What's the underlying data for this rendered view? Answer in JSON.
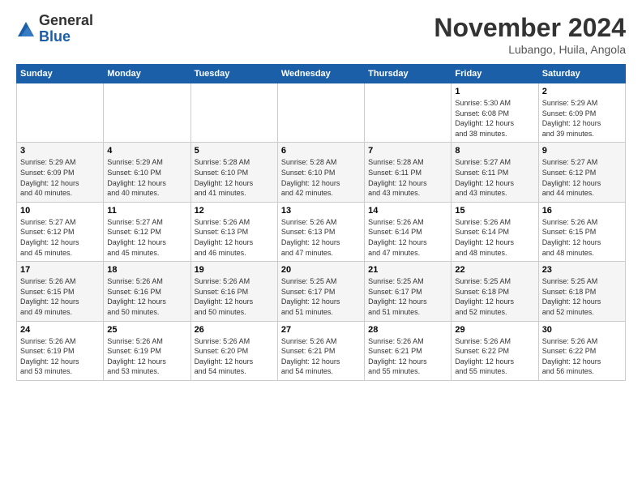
{
  "logo": {
    "general": "General",
    "blue": "Blue"
  },
  "header": {
    "month": "November 2024",
    "location": "Lubango, Huila, Angola"
  },
  "weekdays": [
    "Sunday",
    "Monday",
    "Tuesday",
    "Wednesday",
    "Thursday",
    "Friday",
    "Saturday"
  ],
  "weeks": [
    [
      {
        "day": "",
        "info": ""
      },
      {
        "day": "",
        "info": ""
      },
      {
        "day": "",
        "info": ""
      },
      {
        "day": "",
        "info": ""
      },
      {
        "day": "",
        "info": ""
      },
      {
        "day": "1",
        "info": "Sunrise: 5:30 AM\nSunset: 6:08 PM\nDaylight: 12 hours\nand 38 minutes."
      },
      {
        "day": "2",
        "info": "Sunrise: 5:29 AM\nSunset: 6:09 PM\nDaylight: 12 hours\nand 39 minutes."
      }
    ],
    [
      {
        "day": "3",
        "info": "Sunrise: 5:29 AM\nSunset: 6:09 PM\nDaylight: 12 hours\nand 40 minutes."
      },
      {
        "day": "4",
        "info": "Sunrise: 5:29 AM\nSunset: 6:10 PM\nDaylight: 12 hours\nand 40 minutes."
      },
      {
        "day": "5",
        "info": "Sunrise: 5:28 AM\nSunset: 6:10 PM\nDaylight: 12 hours\nand 41 minutes."
      },
      {
        "day": "6",
        "info": "Sunrise: 5:28 AM\nSunset: 6:10 PM\nDaylight: 12 hours\nand 42 minutes."
      },
      {
        "day": "7",
        "info": "Sunrise: 5:28 AM\nSunset: 6:11 PM\nDaylight: 12 hours\nand 43 minutes."
      },
      {
        "day": "8",
        "info": "Sunrise: 5:27 AM\nSunset: 6:11 PM\nDaylight: 12 hours\nand 43 minutes."
      },
      {
        "day": "9",
        "info": "Sunrise: 5:27 AM\nSunset: 6:12 PM\nDaylight: 12 hours\nand 44 minutes."
      }
    ],
    [
      {
        "day": "10",
        "info": "Sunrise: 5:27 AM\nSunset: 6:12 PM\nDaylight: 12 hours\nand 45 minutes."
      },
      {
        "day": "11",
        "info": "Sunrise: 5:27 AM\nSunset: 6:12 PM\nDaylight: 12 hours\nand 45 minutes."
      },
      {
        "day": "12",
        "info": "Sunrise: 5:26 AM\nSunset: 6:13 PM\nDaylight: 12 hours\nand 46 minutes."
      },
      {
        "day": "13",
        "info": "Sunrise: 5:26 AM\nSunset: 6:13 PM\nDaylight: 12 hours\nand 47 minutes."
      },
      {
        "day": "14",
        "info": "Sunrise: 5:26 AM\nSunset: 6:14 PM\nDaylight: 12 hours\nand 47 minutes."
      },
      {
        "day": "15",
        "info": "Sunrise: 5:26 AM\nSunset: 6:14 PM\nDaylight: 12 hours\nand 48 minutes."
      },
      {
        "day": "16",
        "info": "Sunrise: 5:26 AM\nSunset: 6:15 PM\nDaylight: 12 hours\nand 48 minutes."
      }
    ],
    [
      {
        "day": "17",
        "info": "Sunrise: 5:26 AM\nSunset: 6:15 PM\nDaylight: 12 hours\nand 49 minutes."
      },
      {
        "day": "18",
        "info": "Sunrise: 5:26 AM\nSunset: 6:16 PM\nDaylight: 12 hours\nand 50 minutes."
      },
      {
        "day": "19",
        "info": "Sunrise: 5:26 AM\nSunset: 6:16 PM\nDaylight: 12 hours\nand 50 minutes."
      },
      {
        "day": "20",
        "info": "Sunrise: 5:25 AM\nSunset: 6:17 PM\nDaylight: 12 hours\nand 51 minutes."
      },
      {
        "day": "21",
        "info": "Sunrise: 5:25 AM\nSunset: 6:17 PM\nDaylight: 12 hours\nand 51 minutes."
      },
      {
        "day": "22",
        "info": "Sunrise: 5:25 AM\nSunset: 6:18 PM\nDaylight: 12 hours\nand 52 minutes."
      },
      {
        "day": "23",
        "info": "Sunrise: 5:25 AM\nSunset: 6:18 PM\nDaylight: 12 hours\nand 52 minutes."
      }
    ],
    [
      {
        "day": "24",
        "info": "Sunrise: 5:26 AM\nSunset: 6:19 PM\nDaylight: 12 hours\nand 53 minutes."
      },
      {
        "day": "25",
        "info": "Sunrise: 5:26 AM\nSunset: 6:19 PM\nDaylight: 12 hours\nand 53 minutes."
      },
      {
        "day": "26",
        "info": "Sunrise: 5:26 AM\nSunset: 6:20 PM\nDaylight: 12 hours\nand 54 minutes."
      },
      {
        "day": "27",
        "info": "Sunrise: 5:26 AM\nSunset: 6:21 PM\nDaylight: 12 hours\nand 54 minutes."
      },
      {
        "day": "28",
        "info": "Sunrise: 5:26 AM\nSunset: 6:21 PM\nDaylight: 12 hours\nand 55 minutes."
      },
      {
        "day": "29",
        "info": "Sunrise: 5:26 AM\nSunset: 6:22 PM\nDaylight: 12 hours\nand 55 minutes."
      },
      {
        "day": "30",
        "info": "Sunrise: 5:26 AM\nSunset: 6:22 PM\nDaylight: 12 hours\nand 56 minutes."
      }
    ]
  ]
}
